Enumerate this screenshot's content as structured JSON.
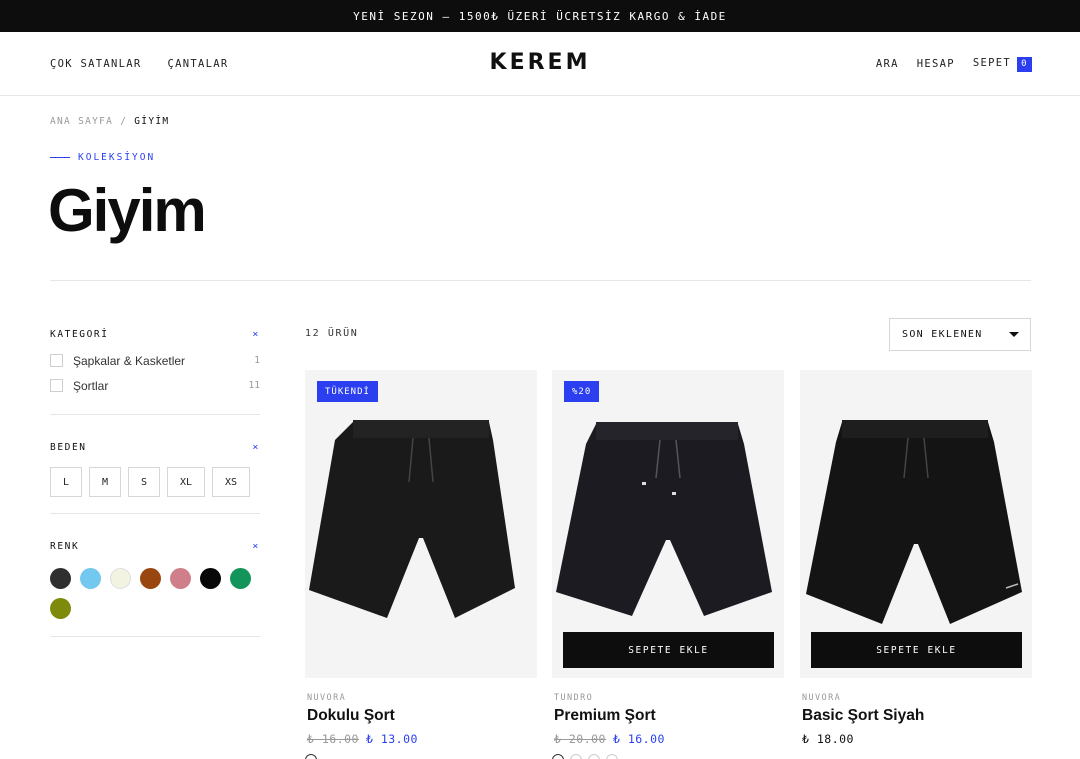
{
  "announcement": "YENİ SEZON — 1500₺ ÜZERİ ÜCRETSİZ KARGO & İADE",
  "header": {
    "nav_left": [
      "ÇOK SATANLAR",
      "ÇANTALAR"
    ],
    "logo": "KEREM",
    "search": "ARA",
    "account": "HESAP",
    "cart": "SEPET",
    "cart_count": "0"
  },
  "breadcrumb": {
    "home": "ANA SAYFA",
    "separator": "/",
    "current": "GİYİM"
  },
  "eyebrow": "KOLEKSİYON",
  "page_title": "Giyim",
  "filters": {
    "category": {
      "title": "KATEGORİ",
      "clear": "×",
      "items": [
        {
          "label": "Şapkalar & Kasketler",
          "count": "1"
        },
        {
          "label": "Şortlar",
          "count": "11"
        }
      ]
    },
    "size": {
      "title": "BEDEN",
      "clear": "×",
      "options": [
        "L",
        "M",
        "S",
        "XL",
        "XS"
      ]
    },
    "color": {
      "title": "RENK",
      "clear": "×",
      "swatches": [
        "#2f2f2f",
        "#72c8ee",
        "#f3f3e2",
        "#9a4611",
        "#cf7f89",
        "#080808",
        "#12945a",
        "#7e8a0b"
      ]
    }
  },
  "results": {
    "count_label": "12 ÜRÜN",
    "sort_label": "SON EKLENEN"
  },
  "products": [
    {
      "badge": "TÜKENDİ",
      "brand": "NUVORA",
      "name": "Dokulu Şort",
      "old_price": "₺ 16.00",
      "price": "₺ 13.00",
      "add_to_cart": "",
      "swatch_count": 1
    },
    {
      "badge": "%20",
      "brand": "TUNDRO",
      "name": "Premium Şort",
      "old_price": "₺ 20.00",
      "price": "₺ 16.00",
      "add_to_cart": "SEPETE EKLE",
      "swatch_count": 4
    },
    {
      "badge": "",
      "brand": "NUVORA",
      "name": "Basic Şort Siyah",
      "old_price": "",
      "price": "₺ 18.00",
      "add_to_cart": "SEPETE EKLE",
      "swatch_count": 0
    }
  ],
  "colors": {
    "accent": "#2b3ff0",
    "dark": "#0d0d0d",
    "muted": "#999999"
  }
}
